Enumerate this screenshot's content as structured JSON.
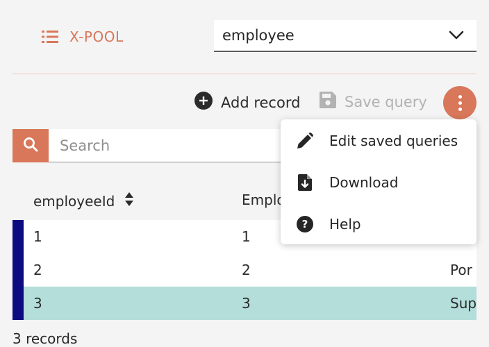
{
  "header": {
    "brand": "X-POOL",
    "table_select": {
      "value": "employee"
    }
  },
  "toolbar": {
    "add_record": "Add record",
    "save_query": "Save query"
  },
  "search": {
    "placeholder": "Search"
  },
  "table": {
    "columns": [
      "employeeId",
      "Emplo"
    ],
    "rows": [
      {
        "cells": [
          "1",
          "1",
          ""
        ],
        "selected": false
      },
      {
        "cells": [
          "2",
          "2",
          "Por"
        ],
        "selected": false
      },
      {
        "cells": [
          "3",
          "3",
          "Sup"
        ],
        "selected": true
      }
    ],
    "record_count": "3 records"
  },
  "menu": {
    "items": [
      {
        "label": "Edit saved queries",
        "icon": "pencil-icon"
      },
      {
        "label": "Download",
        "icon": "download-file-icon"
      },
      {
        "label": "Help",
        "icon": "help-circle-icon"
      }
    ]
  },
  "colors": {
    "accent": "#d8775a",
    "selected_row": "#b3deda",
    "row_marker": "#0c0c80",
    "divider": "#f0c8b8"
  }
}
